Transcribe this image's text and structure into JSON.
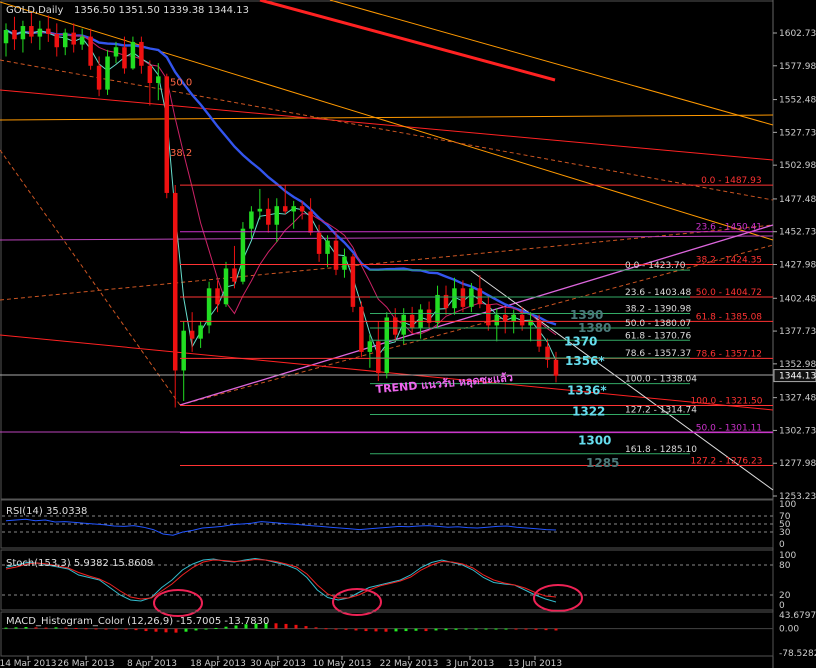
{
  "chart_data": {
    "type": "candlestick",
    "main": {
      "title": "GOLD,Daily",
      "ohlc_text": "1356.50 1351.50 1339.38 1344.13",
      "price_axis": [
        1602.73,
        1577.98,
        1552.48,
        1527.73,
        1502.98,
        1477.48,
        1452.73,
        1427.98,
        1402.48,
        1377.73,
        1352.98,
        1327.48,
        1302.73,
        1277.98,
        1253.23
      ],
      "current_price": "1344.13",
      "candles": [
        [
          1595,
          1610,
          1585,
          1605
        ],
        [
          1605,
          1615,
          1590,
          1598
        ],
        [
          1598,
          1612,
          1588,
          1608
        ],
        [
          1608,
          1618,
          1595,
          1600
        ],
        [
          1600,
          1612,
          1590,
          1606
        ],
        [
          1606,
          1616,
          1596,
          1602
        ],
        [
          1602,
          1610,
          1585,
          1592
        ],
        [
          1592,
          1606,
          1586,
          1603
        ],
        [
          1603,
          1610,
          1588,
          1594
        ],
        [
          1594,
          1606,
          1590,
          1600
        ],
        [
          1600,
          1606,
          1575,
          1578
        ],
        [
          1578,
          1585,
          1555,
          1560
        ],
        [
          1560,
          1590,
          1556,
          1585
        ],
        [
          1585,
          1596,
          1580,
          1592
        ],
        [
          1592,
          1600,
          1572,
          1576
        ],
        [
          1576,
          1600,
          1575,
          1596
        ],
        [
          1596,
          1600,
          1572,
          1578
        ],
        [
          1578,
          1582,
          1548,
          1565
        ],
        [
          1565,
          1580,
          1552,
          1570
        ],
        [
          1570,
          1572,
          1478,
          1482
        ],
        [
          1482,
          1488,
          1320,
          1348
        ],
        [
          1348,
          1385,
          1325,
          1378
        ],
        [
          1378,
          1392,
          1362,
          1372
        ],
        [
          1372,
          1385,
          1365,
          1382
        ],
        [
          1382,
          1415,
          1376,
          1410
        ],
        [
          1410,
          1416,
          1392,
          1398
        ],
        [
          1398,
          1430,
          1396,
          1425
        ],
        [
          1425,
          1442,
          1410,
          1415
        ],
        [
          1415,
          1460,
          1413,
          1455
        ],
        [
          1455,
          1472,
          1448,
          1468
        ],
        [
          1468,
          1485,
          1462,
          1470
        ],
        [
          1470,
          1478,
          1452,
          1458
        ],
        [
          1458,
          1478,
          1445,
          1472
        ],
        [
          1472,
          1488,
          1466,
          1468
        ],
        [
          1468,
          1476,
          1455,
          1472
        ],
        [
          1472,
          1476,
          1462,
          1468
        ],
        [
          1468,
          1478,
          1450,
          1452
        ],
        [
          1452,
          1458,
          1430,
          1436
        ],
        [
          1436,
          1450,
          1426,
          1446
        ],
        [
          1446,
          1452,
          1420,
          1424
        ],
        [
          1424,
          1440,
          1418,
          1434
        ],
        [
          1434,
          1436,
          1392,
          1396
        ],
        [
          1396,
          1400,
          1358,
          1362
        ],
        [
          1362,
          1375,
          1350,
          1370
        ],
        [
          1370,
          1385,
          1340,
          1346
        ],
        [
          1346,
          1392,
          1342,
          1388
        ],
        [
          1388,
          1395,
          1370,
          1375
        ],
        [
          1375,
          1395,
          1368,
          1390
        ],
        [
          1390,
          1396,
          1376,
          1380
        ],
        [
          1380,
          1398,
          1372,
          1394
        ],
        [
          1394,
          1400,
          1380,
          1384
        ],
        [
          1384,
          1412,
          1380,
          1405
        ],
        [
          1405,
          1412,
          1390,
          1395
        ],
        [
          1395,
          1418,
          1390,
          1410
        ],
        [
          1410,
          1416,
          1392,
          1396
        ],
        [
          1396,
          1414,
          1392,
          1410
        ],
        [
          1410,
          1420,
          1395,
          1398
        ],
        [
          1398,
          1404,
          1378,
          1382
        ],
        [
          1382,
          1395,
          1370,
          1390
        ],
        [
          1390,
          1396,
          1376,
          1385
        ],
        [
          1385,
          1394,
          1376,
          1390
        ],
        [
          1390,
          1396,
          1378,
          1382
        ],
        [
          1382,
          1392,
          1370,
          1386
        ],
        [
          1386,
          1390,
          1362,
          1366
        ],
        [
          1366,
          1372,
          1350,
          1356
        ],
        [
          1356,
          1362,
          1339,
          1344
        ]
      ],
      "date_labels": [
        "14 Mar 2013",
        "26 Mar 2013",
        "8 Apr 2013",
        "18 Apr 2013",
        "30 Apr 2013",
        "10 May 2013",
        "22 May 2013",
        "3 Jun 2013",
        "13 Jun 2013"
      ],
      "fib_left": [
        {
          "price": 1487.93,
          "text": "0.0 - 1487.93",
          "color": "#ff3333"
        },
        {
          "price": 1452.73,
          "text": "23.6 - 1450.41",
          "color": "#cc33cc"
        },
        {
          "price": 1427.98,
          "text": "38.2 - 1424.35",
          "color": "#ff3333"
        },
        {
          "price": 1403.48,
          "text": "50.0 - 1404.72",
          "color": "#ff3333"
        },
        {
          "price": 1385.08,
          "text": "61.8 - 1385.08",
          "color": "#ff3333"
        },
        {
          "price": 1357.12,
          "text": "78.6 - 1357.12",
          "color": "#ff3333"
        },
        {
          "price": 1321.5,
          "text": "100.0 - 1321.50",
          "color": "#ff3333"
        },
        {
          "price": 1301.11,
          "text": "50.0 - 1301.11",
          "color": "#cc33cc"
        },
        {
          "price": 1276.23,
          "text": "127.2 - 1276.23",
          "color": "#ff3333"
        }
      ],
      "fib_right": [
        {
          "price": 1423.7,
          "text": "0.0 - 1423.70"
        },
        {
          "price": 1403.48,
          "text": "23.6 - 1403.48"
        },
        {
          "price": 1390.98,
          "text": "38.2 - 1390.98"
        },
        {
          "price": 1380.07,
          "text": "50.0 - 1380.07"
        },
        {
          "price": 1370.76,
          "text": "61.8 - 1370.76"
        },
        {
          "price": 1357.37,
          "text": "78.6 - 1357.37"
        },
        {
          "price": 1338.04,
          "text": "100.0 - 1338.04"
        },
        {
          "price": 1314.74,
          "text": "127.2 - 1314.74"
        },
        {
          "price": 1285.1,
          "text": "161.8 - 1285.10"
        }
      ],
      "level_labels": [
        {
          "text": "1390",
          "price": 1390,
          "color": "#4a7a7a",
          "size": 12
        },
        {
          "text": "1380",
          "price": 1380,
          "color": "#4a7a7a",
          "size": 12
        },
        {
          "text": "1370",
          "price": 1370,
          "color": "#66ddee",
          "size": 12
        },
        {
          "text": "1356*",
          "price": 1355,
          "color": "#66ddee",
          "size": 12
        },
        {
          "text": "1336*",
          "price": 1333,
          "color": "#66ddee",
          "size": 12
        },
        {
          "text": "1322",
          "price": 1317,
          "color": "#66ddee",
          "size": 12
        },
        {
          "text": "1300",
          "price": 1295,
          "color": "#66ddee",
          "size": 12
        },
        {
          "text": "1285",
          "price": 1278,
          "color": "#4a7a7a",
          "size": 12
        }
      ],
      "left_labels": [
        {
          "text": "50.0",
          "price": 1563
        },
        {
          "text": "38.2",
          "price": 1510
        }
      ],
      "annotation": "TREND แนวรับ หลุดซะแล้ว"
    },
    "rsi": {
      "title": "RSI(14) 35.0338",
      "levels": [
        "70",
        "50",
        "30",
        "0"
      ],
      "axis": [
        "100",
        "70",
        "50",
        "30",
        "0"
      ],
      "values": [
        58,
        60,
        62,
        58,
        60,
        55,
        56,
        54,
        52,
        50,
        48,
        45,
        44,
        46,
        42,
        36,
        25,
        22,
        30,
        34,
        40,
        42,
        44,
        48,
        50,
        52,
        56,
        54,
        52,
        50,
        48,
        46,
        44,
        42,
        40,
        38,
        36,
        38,
        40,
        42,
        44,
        43,
        45,
        46,
        44,
        42,
        43,
        41,
        40,
        42,
        44,
        45,
        42,
        40,
        38,
        36,
        35
      ]
    },
    "stoch": {
      "title": "Stoch(153,3) 5.9382 15.8609",
      "axis": [
        "100",
        "80",
        "20",
        "0"
      ],
      "main": [
        75,
        80,
        85,
        84,
        80,
        76,
        72,
        60,
        55,
        50,
        35,
        20,
        10,
        8,
        15,
        35,
        50,
        70,
        82,
        90,
        92,
        88,
        86,
        90,
        93,
        90,
        85,
        80,
        72,
        55,
        30,
        15,
        10,
        14,
        25,
        35,
        40,
        45,
        50,
        60,
        75,
        85,
        90,
        85,
        80,
        70,
        55,
        45,
        42,
        40,
        30,
        20,
        12,
        6
      ],
      "signal": [
        72,
        76,
        82,
        84,
        82,
        78,
        74,
        65,
        58,
        52,
        42,
        28,
        16,
        12,
        14,
        28,
        42,
        60,
        75,
        86,
        90,
        89,
        87,
        88,
        91,
        90,
        87,
        82,
        76,
        62,
        40,
        22,
        14,
        14,
        20,
        30,
        38,
        43,
        48,
        56,
        70,
        80,
        87,
        86,
        82,
        74,
        60,
        50,
        44,
        40,
        34,
        25,
        18,
        16
      ]
    },
    "macd": {
      "title": "MACD_Histogram_Color (12,26,9) -15.7005 -13.7830",
      "axis": [
        "43.6797",
        "0.00",
        "-78.5282"
      ],
      "values": [
        3,
        4,
        5,
        4,
        3,
        4,
        3,
        2,
        1,
        0.5,
        -0.5,
        -1,
        -2,
        -5,
        -8,
        -10,
        -12,
        -13,
        -10,
        -6,
        -2,
        2,
        6,
        10,
        14,
        16,
        18,
        17,
        15,
        12,
        8,
        4,
        1,
        -2,
        -4,
        -6,
        -8,
        -9,
        -10,
        -9,
        -8,
        -7,
        -8,
        -6,
        -5,
        -4,
        -3,
        -2,
        -2,
        -1,
        -1,
        -2,
        -3,
        -4,
        -5,
        -6
      ]
    }
  }
}
